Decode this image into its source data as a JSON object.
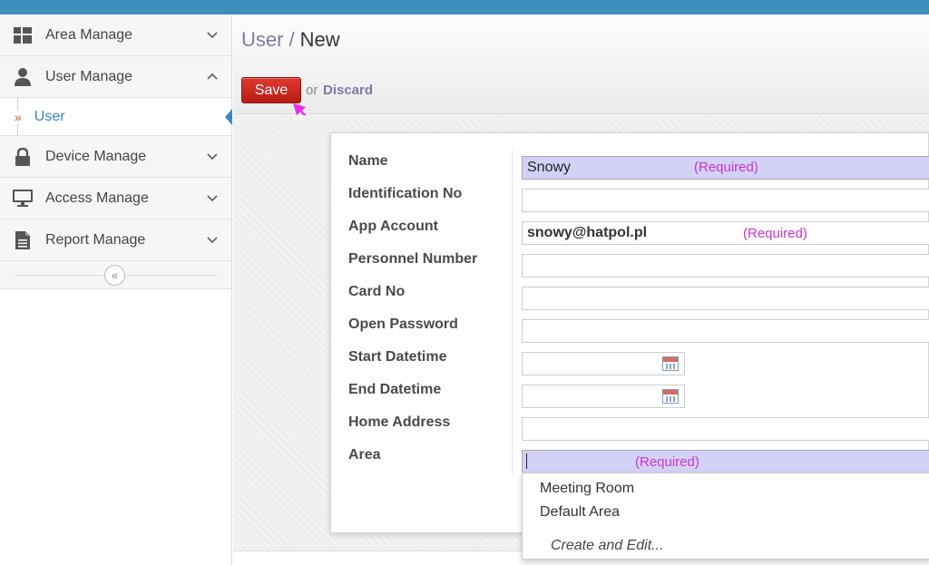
{
  "sidebar": {
    "items": [
      {
        "label": "Area Manage"
      },
      {
        "label": "User Manage"
      },
      {
        "label": "Device Manage"
      },
      {
        "label": "Access Manage"
      },
      {
        "label": "Report Manage"
      }
    ],
    "sub_item": {
      "marker": "»",
      "label": "User"
    },
    "collapse_symbol": "«"
  },
  "header": {
    "breadcrumb_parent": "User",
    "breadcrumb_separator": "/",
    "breadcrumb_current": "New",
    "save_label": "Save",
    "or_text": "or",
    "discard_label": "Discard"
  },
  "form": {
    "required_hint": "(Required)",
    "fields": [
      {
        "label": "Name",
        "value": "Snowy"
      },
      {
        "label": "Identification No",
        "value": ""
      },
      {
        "label": "App Account",
        "value": "snowy@hatpol.pl"
      },
      {
        "label": "Personnel Number",
        "value": ""
      },
      {
        "label": "Card No",
        "value": ""
      },
      {
        "label": "Open Password",
        "value": ""
      },
      {
        "label": "Start Datetime",
        "value": ""
      },
      {
        "label": "End Datetime",
        "value": ""
      },
      {
        "label": "Home Address",
        "value": ""
      },
      {
        "label": "Area",
        "value": ""
      }
    ]
  },
  "dropdown": {
    "options": [
      "Meeting Room",
      "Default Area"
    ],
    "create_label": "Create and Edit..."
  },
  "colors": {
    "topbar": "#3d8dbf",
    "required_bg": "#d2d2f7",
    "required_text": "#cc33cc",
    "save_button": "#c9261d",
    "link": "#7b7ba8",
    "sidebar_active": "#3a87c7"
  }
}
